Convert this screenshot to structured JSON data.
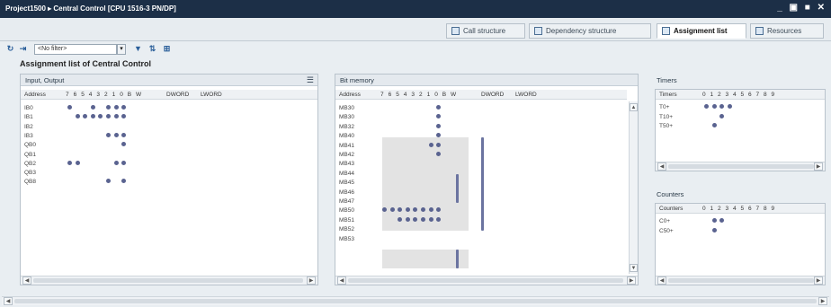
{
  "window": {
    "title": "Project1500 ▸ Central Control [CPU 1516-3 PN/DP]",
    "controls": [
      "_",
      "▣",
      "■",
      "✕"
    ]
  },
  "tabs": [
    {
      "label": "Call structure",
      "active": false
    },
    {
      "label": "Dependency structure",
      "active": false
    },
    {
      "label": "Assignment list",
      "active": true
    },
    {
      "label": "Resources",
      "active": false
    }
  ],
  "toolbar": {
    "filter_value": "<No filter>",
    "icons": [
      "refresh-icon",
      "assign-icon",
      "sort-icon",
      "filter-icon",
      "cross-reference-icon",
      "overlap-icon"
    ]
  },
  "page_title": "Assignment list of Central Control",
  "io_panel": {
    "title": "Input, Output",
    "columns": [
      "Address",
      "7",
      "6",
      "5",
      "4",
      "3",
      "2",
      "1",
      "0",
      "B",
      "W",
      "DWORD",
      "LWORD"
    ],
    "rows": [
      {
        "address": "IB0",
        "bits": [
          7,
          4,
          2,
          1,
          0
        ]
      },
      {
        "address": "IB1",
        "bits": [
          6,
          5,
          4,
          3,
          2,
          1,
          0
        ]
      },
      {
        "address": "IB2",
        "bits": []
      },
      {
        "address": "IB3",
        "bits": [
          2,
          1,
          0
        ]
      },
      {
        "address": "QB0",
        "bits": [
          0
        ]
      },
      {
        "address": "QB1",
        "bits": []
      },
      {
        "address": "QB2",
        "bits": [
          7,
          6,
          1,
          0
        ]
      },
      {
        "address": "QB3",
        "bits": []
      },
      {
        "address": "QB8",
        "bits": [
          2,
          0
        ]
      }
    ]
  },
  "bit_memory_panel": {
    "title": "Bit memory",
    "columns": [
      "Address",
      "7",
      "6",
      "5",
      "4",
      "3",
      "2",
      "1",
      "0",
      "B",
      "W",
      "DWORD",
      "LWORD"
    ],
    "rows": [
      {
        "address": "MB30",
        "bits": [
          0
        ]
      },
      {
        "address": "MB30",
        "bits": [
          0
        ]
      },
      {
        "address": "MB32",
        "bits": [
          0
        ]
      },
      {
        "address": "MB40",
        "bits": [
          0
        ]
      },
      {
        "address": "MB41",
        "bits": [
          1,
          0
        ]
      },
      {
        "address": "MB42",
        "bits": [
          0
        ]
      },
      {
        "address": "MB43",
        "bits": []
      },
      {
        "address": "MB44",
        "bits": []
      },
      {
        "address": "MB45",
        "bits": []
      },
      {
        "address": "MB46",
        "bits": []
      },
      {
        "address": "MB47",
        "bits": []
      },
      {
        "address": "MB50",
        "bits": [
          7,
          6,
          5,
          4,
          3,
          2,
          1,
          0
        ]
      },
      {
        "address": "MB51",
        "bits": [
          5,
          4,
          3,
          2,
          1,
          0
        ]
      },
      {
        "address": "MB52",
        "bits": []
      },
      {
        "address": "MB53",
        "bits": []
      }
    ]
  },
  "timers_panel": {
    "title": "Timers",
    "columns": [
      "Timers",
      "0",
      "1",
      "2",
      "3",
      "4",
      "5",
      "6",
      "7",
      "8",
      "9"
    ],
    "rows": [
      {
        "address": "T0+",
        "bits": [
          0,
          1,
          2,
          3
        ]
      },
      {
        "address": "T10+",
        "bits": [
          2
        ]
      },
      {
        "address": "T50+",
        "bits": [
          1
        ]
      }
    ]
  },
  "counters_panel": {
    "title": "Counters",
    "columns": [
      "Counters",
      "0",
      "1",
      "2",
      "3",
      "4",
      "5",
      "6",
      "7",
      "8",
      "9"
    ],
    "rows": [
      {
        "address": "C0+",
        "bits": [
          1,
          2
        ]
      },
      {
        "address": "C50+",
        "bits": [
          1
        ]
      }
    ]
  },
  "colors": {
    "titlebar": "#1c2f47",
    "dot": "#5a6390",
    "shade": "#e3e3e3"
  }
}
